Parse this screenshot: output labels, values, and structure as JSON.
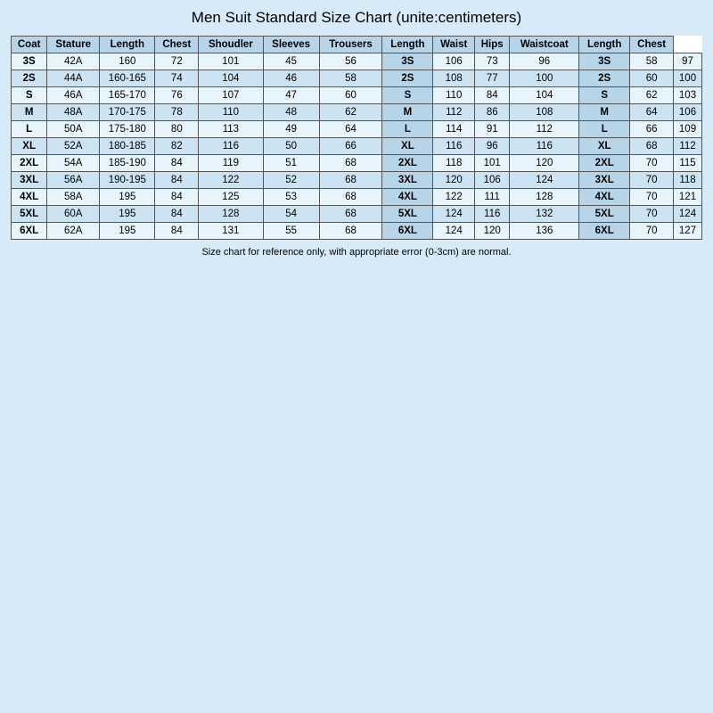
{
  "title": "Men Suit Standard Size Chart   (unite:centimeters)",
  "headers": [
    {
      "label": "Coat",
      "colspan": 1
    },
    {
      "label": "Stature",
      "colspan": 1
    },
    {
      "label": "Length",
      "colspan": 1
    },
    {
      "label": "Chest",
      "colspan": 1
    },
    {
      "label": "Shoudler",
      "colspan": 1
    },
    {
      "label": "Sleeves",
      "colspan": 1
    },
    {
      "label": "Trousers",
      "colspan": 1,
      "bold": true
    },
    {
      "label": "Length",
      "colspan": 1
    },
    {
      "label": "Waist",
      "colspan": 1
    },
    {
      "label": "Hips",
      "colspan": 1
    },
    {
      "label": "Waistcoat",
      "colspan": 1,
      "bold": true
    },
    {
      "label": "Length",
      "colspan": 1
    },
    {
      "label": "Chest",
      "colspan": 1
    }
  ],
  "rows": [
    {
      "coat": "3S",
      "coat2": "42A",
      "stature": "160",
      "length": "72",
      "chest": "101",
      "shoulder": "45",
      "sleeves": "56",
      "trousers": "3S",
      "t_length": "106",
      "waist": "73",
      "hips": "96",
      "waistcoat": "3S",
      "w_length": "58",
      "w_chest": "97"
    },
    {
      "coat": "2S",
      "coat2": "44A",
      "stature": "160-165",
      "length": "74",
      "chest": "104",
      "shoulder": "46",
      "sleeves": "58",
      "trousers": "2S",
      "t_length": "108",
      "waist": "77",
      "hips": "100",
      "waistcoat": "2S",
      "w_length": "60",
      "w_chest": "100"
    },
    {
      "coat": "S",
      "coat2": "46A",
      "stature": "165-170",
      "length": "76",
      "chest": "107",
      "shoulder": "47",
      "sleeves": "60",
      "trousers": "S",
      "t_length": "110",
      "waist": "84",
      "hips": "104",
      "waistcoat": "S",
      "w_length": "62",
      "w_chest": "103"
    },
    {
      "coat": "M",
      "coat2": "48A",
      "stature": "170-175",
      "length": "78",
      "chest": "110",
      "shoulder": "48",
      "sleeves": "62",
      "trousers": "M",
      "t_length": "112",
      "waist": "86",
      "hips": "108",
      "waistcoat": "M",
      "w_length": "64",
      "w_chest": "106"
    },
    {
      "coat": "L",
      "coat2": "50A",
      "stature": "175-180",
      "length": "80",
      "chest": "113",
      "shoulder": "49",
      "sleeves": "64",
      "trousers": "L",
      "t_length": "114",
      "waist": "91",
      "hips": "112",
      "waistcoat": "L",
      "w_length": "66",
      "w_chest": "109"
    },
    {
      "coat": "XL",
      "coat2": "52A",
      "stature": "180-185",
      "length": "82",
      "chest": "116",
      "shoulder": "50",
      "sleeves": "66",
      "trousers": "XL",
      "t_length": "116",
      "waist": "96",
      "hips": "116",
      "waistcoat": "XL",
      "w_length": "68",
      "w_chest": "112"
    },
    {
      "coat": "2XL",
      "coat2": "54A",
      "stature": "185-190",
      "length": "84",
      "chest": "119",
      "shoulder": "51",
      "sleeves": "68",
      "trousers": "2XL",
      "t_length": "118",
      "waist": "101",
      "hips": "120",
      "waistcoat": "2XL",
      "w_length": "70",
      "w_chest": "115"
    },
    {
      "coat": "3XL",
      "coat2": "56A",
      "stature": "190-195",
      "length": "84",
      "chest": "122",
      "shoulder": "52",
      "sleeves": "68",
      "trousers": "3XL",
      "t_length": "120",
      "waist": "106",
      "hips": "124",
      "waistcoat": "3XL",
      "w_length": "70",
      "w_chest": "118"
    },
    {
      "coat": "4XL",
      "coat2": "58A",
      "stature": "195",
      "length": "84",
      "chest": "125",
      "shoulder": "53",
      "sleeves": "68",
      "trousers": "4XL",
      "t_length": "122",
      "waist": "111",
      "hips": "128",
      "waistcoat": "4XL",
      "w_length": "70",
      "w_chest": "121"
    },
    {
      "coat": "5XL",
      "coat2": "60A",
      "stature": "195",
      "length": "84",
      "chest": "128",
      "shoulder": "54",
      "sleeves": "68",
      "trousers": "5XL",
      "t_length": "124",
      "waist": "116",
      "hips": "132",
      "waistcoat": "5XL",
      "w_length": "70",
      "w_chest": "124"
    },
    {
      "coat": "6XL",
      "coat2": "62A",
      "stature": "195",
      "length": "84",
      "chest": "131",
      "shoulder": "55",
      "sleeves": "68",
      "trousers": "6XL",
      "t_length": "124",
      "waist": "120",
      "hips": "136",
      "waistcoat": "6XL",
      "w_length": "70",
      "w_chest": "127"
    }
  ],
  "footer": "Size chart for reference only, with appropriate error (0-3cm) are normal."
}
